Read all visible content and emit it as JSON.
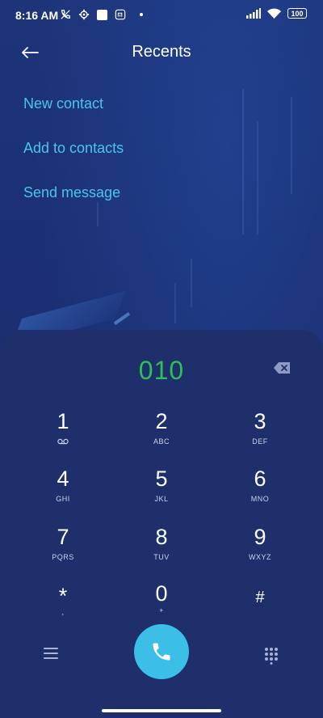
{
  "status_bar": {
    "time": "8:16 AM",
    "battery": "100"
  },
  "header": {
    "title": "Recents"
  },
  "menu": [
    {
      "label": "New contact"
    },
    {
      "label": "Add to contacts"
    },
    {
      "label": "Send message"
    }
  ],
  "dialer": {
    "number": "010"
  },
  "keys": [
    {
      "digit": "1",
      "letters": ""
    },
    {
      "digit": "2",
      "letters": "ABC"
    },
    {
      "digit": "3",
      "letters": "DEF"
    },
    {
      "digit": "4",
      "letters": "GHI"
    },
    {
      "digit": "5",
      "letters": "JKL"
    },
    {
      "digit": "6",
      "letters": "MNO"
    },
    {
      "digit": "7",
      "letters": "PQRS"
    },
    {
      "digit": "8",
      "letters": "TUV"
    },
    {
      "digit": "9",
      "letters": "WXYZ"
    },
    {
      "digit": "*",
      "letters": ","
    },
    {
      "digit": "0",
      "letters": "+"
    },
    {
      "digit": "#",
      "letters": ""
    }
  ],
  "colors": {
    "background": "#1b2f6e",
    "accent": "#4cc3ee",
    "number": "#2fbf55",
    "call_button": "#3bbfe6"
  }
}
